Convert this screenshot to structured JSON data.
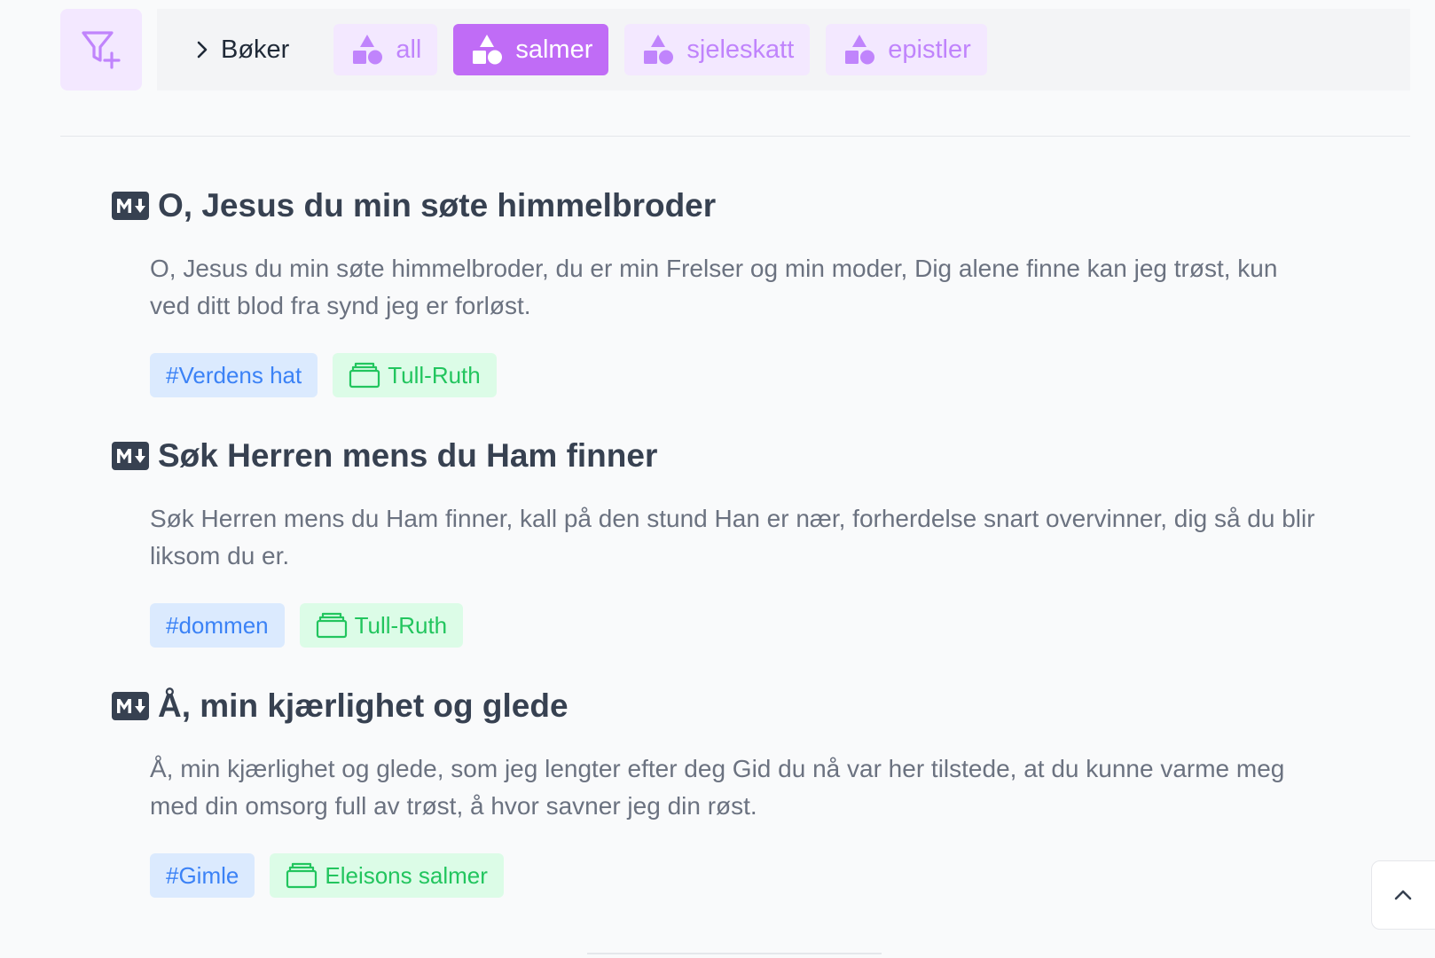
{
  "toolbar": {
    "filter_icon": "filter-plus-icon",
    "breadcrumb": {
      "icon": "chevron-right-icon",
      "label": "Bøker"
    },
    "chips": [
      {
        "label": "all",
        "icon": "shapes-icon",
        "active": false
      },
      {
        "label": "salmer",
        "icon": "shapes-icon",
        "active": true
      },
      {
        "label": "sjeleskatt",
        "icon": "shapes-icon",
        "active": false
      },
      {
        "label": "epistler",
        "icon": "shapes-icon",
        "active": false
      }
    ]
  },
  "documents": [
    {
      "icon": "markdown-icon",
      "title": "O, Jesus du min søte himmelbroder",
      "excerpt": "O, Jesus du min søte himmelbroder, du er min Frelser og min moder, Dig alene finne kan jeg trøst, kun ved ditt blod fra synd jeg er forløst.",
      "tag": "#Verdens hat",
      "collection": "Tull-Ruth"
    },
    {
      "icon": "markdown-icon",
      "title": "Søk Herren mens du Ham finner",
      "excerpt": "Søk Herren mens du Ham finner, kall på den stund Han er nær, forherdelse snart overvinner, dig så du blir liksom du er.",
      "tag": "#dommen",
      "collection": "Tull-Ruth"
    },
    {
      "icon": "markdown-icon",
      "title": "Å, min kjærlighet og glede",
      "excerpt": "Å, min kjærlighet og glede, som jeg lengter efter deg Gid du nå var her tilstede, at du kunne varme meg med din omsorg full av trøst, å hvor savner jeg din røst.",
      "tag": "#Gimle",
      "collection": "Eleisons salmer"
    }
  ],
  "scroll_top_icon": "chevron-up-icon",
  "colors": {
    "accent": "#c06cf6",
    "accent_light": "#f3e8ff",
    "tag_blue": "#3b82f6",
    "tag_green": "#22c55e"
  }
}
